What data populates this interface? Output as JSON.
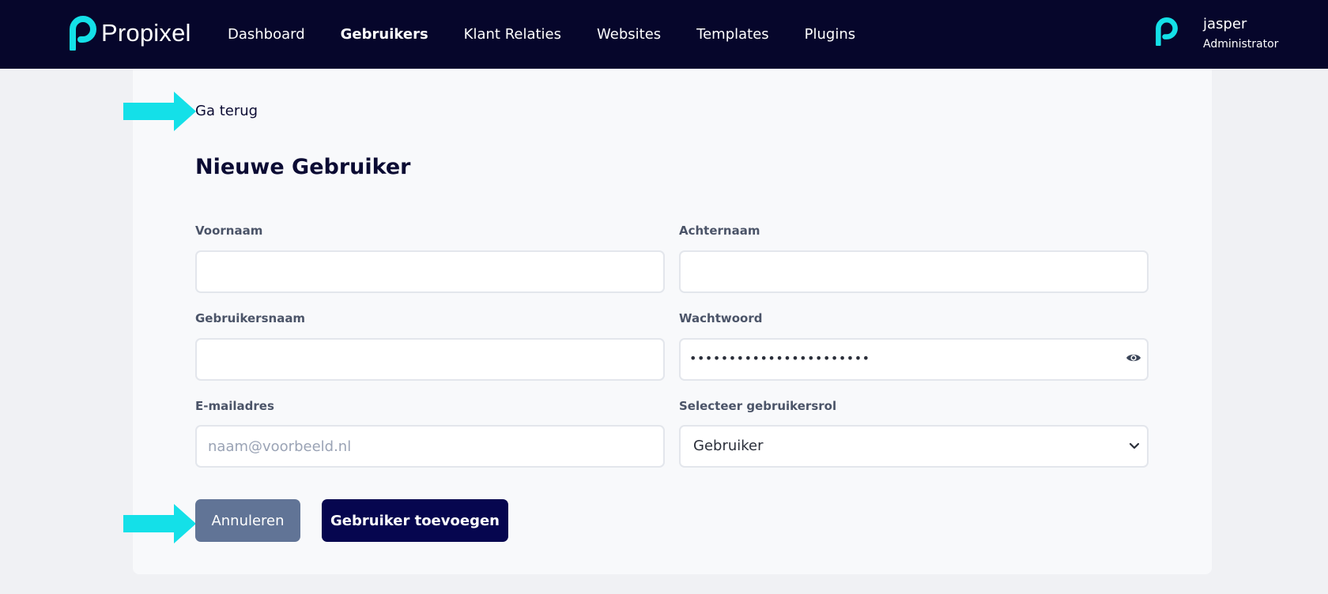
{
  "header": {
    "brand": "Propixel",
    "nav": [
      {
        "label": "Dashboard",
        "active": false
      },
      {
        "label": "Gebruikers",
        "active": true
      },
      {
        "label": "Klant Relaties",
        "active": false
      },
      {
        "label": "Websites",
        "active": false
      },
      {
        "label": "Templates",
        "active": false
      },
      {
        "label": "Plugins",
        "active": false
      }
    ],
    "user": {
      "name": "jasper",
      "role": "Administrator"
    }
  },
  "form": {
    "back_label": "Ga terug",
    "title": "Nieuwe Gebruiker",
    "fields": {
      "first_name": {
        "label": "Voornaam",
        "value": "",
        "placeholder": ""
      },
      "last_name": {
        "label": "Achternaam",
        "value": "",
        "placeholder": ""
      },
      "username": {
        "label": "Gebruikersnaam",
        "value": "",
        "placeholder": ""
      },
      "password": {
        "label": "Wachtwoord",
        "masked_value": "•••••••••••••••••••••••"
      },
      "email": {
        "label": "E-mailadres",
        "value": "",
        "placeholder": "naam@voorbeeld.nl"
      },
      "role": {
        "label": "Selecteer gebruikersrol",
        "selected": "Gebruiker"
      }
    },
    "cancel_label": "Annuleren",
    "submit_label": "Gebruiker toevoegen"
  },
  "colors": {
    "header_bg": "#06062b",
    "accent_cyan": "#14e0e8",
    "cancel_bg": "#617496",
    "submit_bg": "#06064f",
    "card_bg": "#f8f9fb",
    "page_bg": "#f0f1f4"
  },
  "icons": {
    "brand_logo": "p-logo-icon",
    "user_avatar": "p-logo-icon",
    "password_toggle": "eye-icon",
    "select_caret": "chevron-down-icon",
    "annotation": "arrow-right-icon"
  }
}
